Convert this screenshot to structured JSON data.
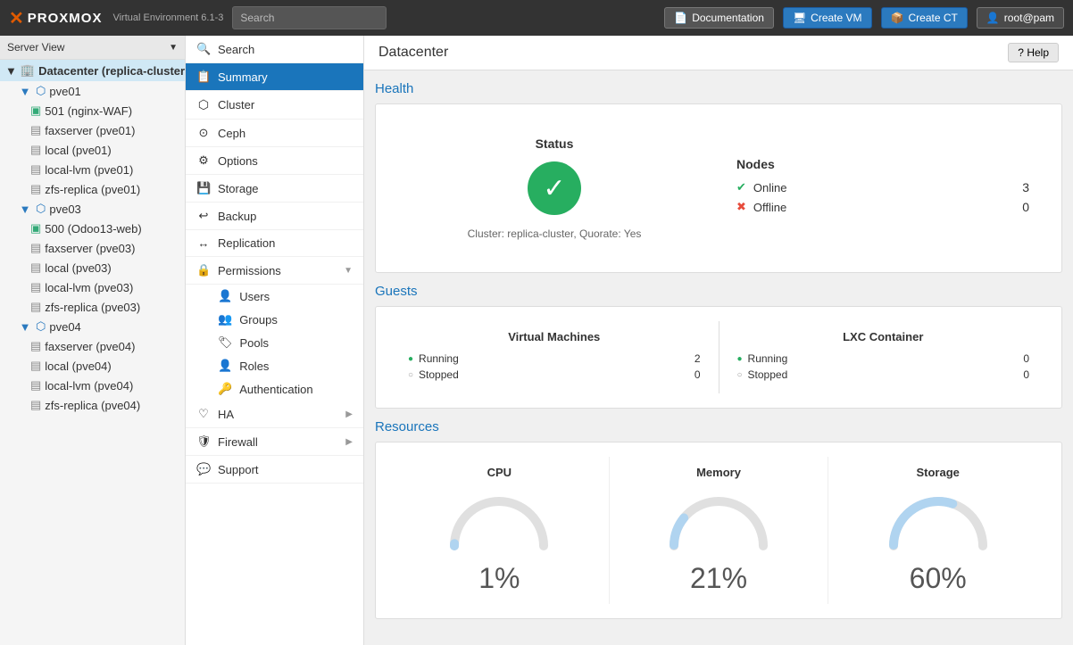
{
  "topbar": {
    "logo_x": "×",
    "logo_text": "PROXMOX",
    "logo_sub": "Virtual Environment 6.1-3",
    "search_placeholder": "Search",
    "btn_documentation": "Documentation",
    "btn_create_vm": "Create VM",
    "btn_create_ct": "Create CT",
    "btn_user": "root@pam"
  },
  "left_panel": {
    "server_view_label": "Server View",
    "datacenter_label": "Datacenter (replica-cluster)",
    "nodes": [
      {
        "name": "pve01",
        "items": [
          "501 (nginx-WAF)",
          "faxserver (pve01)",
          "local (pve01)",
          "local-lvm (pve01)",
          "zfs-replica (pve01)"
        ]
      },
      {
        "name": "pve03",
        "items": [
          "500 (Odoo13-web)",
          "faxserver (pve03)",
          "local (pve03)",
          "local-lvm (pve03)",
          "zfs-replica (pve03)"
        ]
      },
      {
        "name": "pve04",
        "items": [
          "faxserver (pve04)",
          "local (pve04)",
          "local-lvm (pve04)",
          "zfs-replica (pve04)"
        ]
      }
    ]
  },
  "nav": {
    "items": [
      {
        "id": "search",
        "label": "Search",
        "icon": "🔍"
      },
      {
        "id": "summary",
        "label": "Summary",
        "icon": "📋",
        "active": true
      },
      {
        "id": "cluster",
        "label": "Cluster",
        "icon": "🖧"
      },
      {
        "id": "ceph",
        "label": "Ceph",
        "icon": "⚙"
      },
      {
        "id": "options",
        "label": "Options",
        "icon": "⚙"
      },
      {
        "id": "storage",
        "label": "Storage",
        "icon": "💾"
      },
      {
        "id": "backup",
        "label": "Backup",
        "icon": "↩"
      },
      {
        "id": "replication",
        "label": "Replication",
        "icon": "↔"
      },
      {
        "id": "permissions",
        "label": "Permissions",
        "icon": "🔒",
        "expandable": true
      },
      {
        "id": "users",
        "label": "Users",
        "icon": "👤",
        "sub": true
      },
      {
        "id": "groups",
        "label": "Groups",
        "icon": "👥",
        "sub": true
      },
      {
        "id": "pools",
        "label": "Pools",
        "icon": "🏷",
        "sub": true
      },
      {
        "id": "roles",
        "label": "Roles",
        "icon": "👤",
        "sub": true
      },
      {
        "id": "authentication",
        "label": "Authentication",
        "icon": "🔑",
        "sub": true
      },
      {
        "id": "ha",
        "label": "HA",
        "icon": "♡",
        "expandable": true
      },
      {
        "id": "firewall",
        "label": "Firewall",
        "icon": "🛡",
        "expandable": true
      },
      {
        "id": "support",
        "label": "Support",
        "icon": "💬"
      }
    ]
  },
  "content": {
    "title": "Datacenter",
    "help_label": "Help",
    "health": {
      "section_title": "Health",
      "status_label": "Status",
      "nodes_label": "Nodes",
      "online_label": "Online",
      "online_count": "3",
      "offline_label": "Offline",
      "offline_count": "0",
      "cluster_info": "Cluster: replica-cluster, Quorate: Yes"
    },
    "guests": {
      "section_title": "Guests",
      "vm_title": "Virtual Machines",
      "vm_running_label": "Running",
      "vm_running_count": "2",
      "vm_stopped_label": "Stopped",
      "vm_stopped_count": "0",
      "lxc_title": "LXC Container",
      "lxc_running_label": "Running",
      "lxc_running_count": "0",
      "lxc_stopped_label": "Stopped",
      "lxc_stopped_count": "0"
    },
    "resources": {
      "section_title": "Resources",
      "cpu_title": "CPU",
      "cpu_pct": "1%",
      "memory_title": "Memory",
      "memory_pct": "21%",
      "storage_title": "Storage",
      "storage_pct": "60%"
    }
  }
}
